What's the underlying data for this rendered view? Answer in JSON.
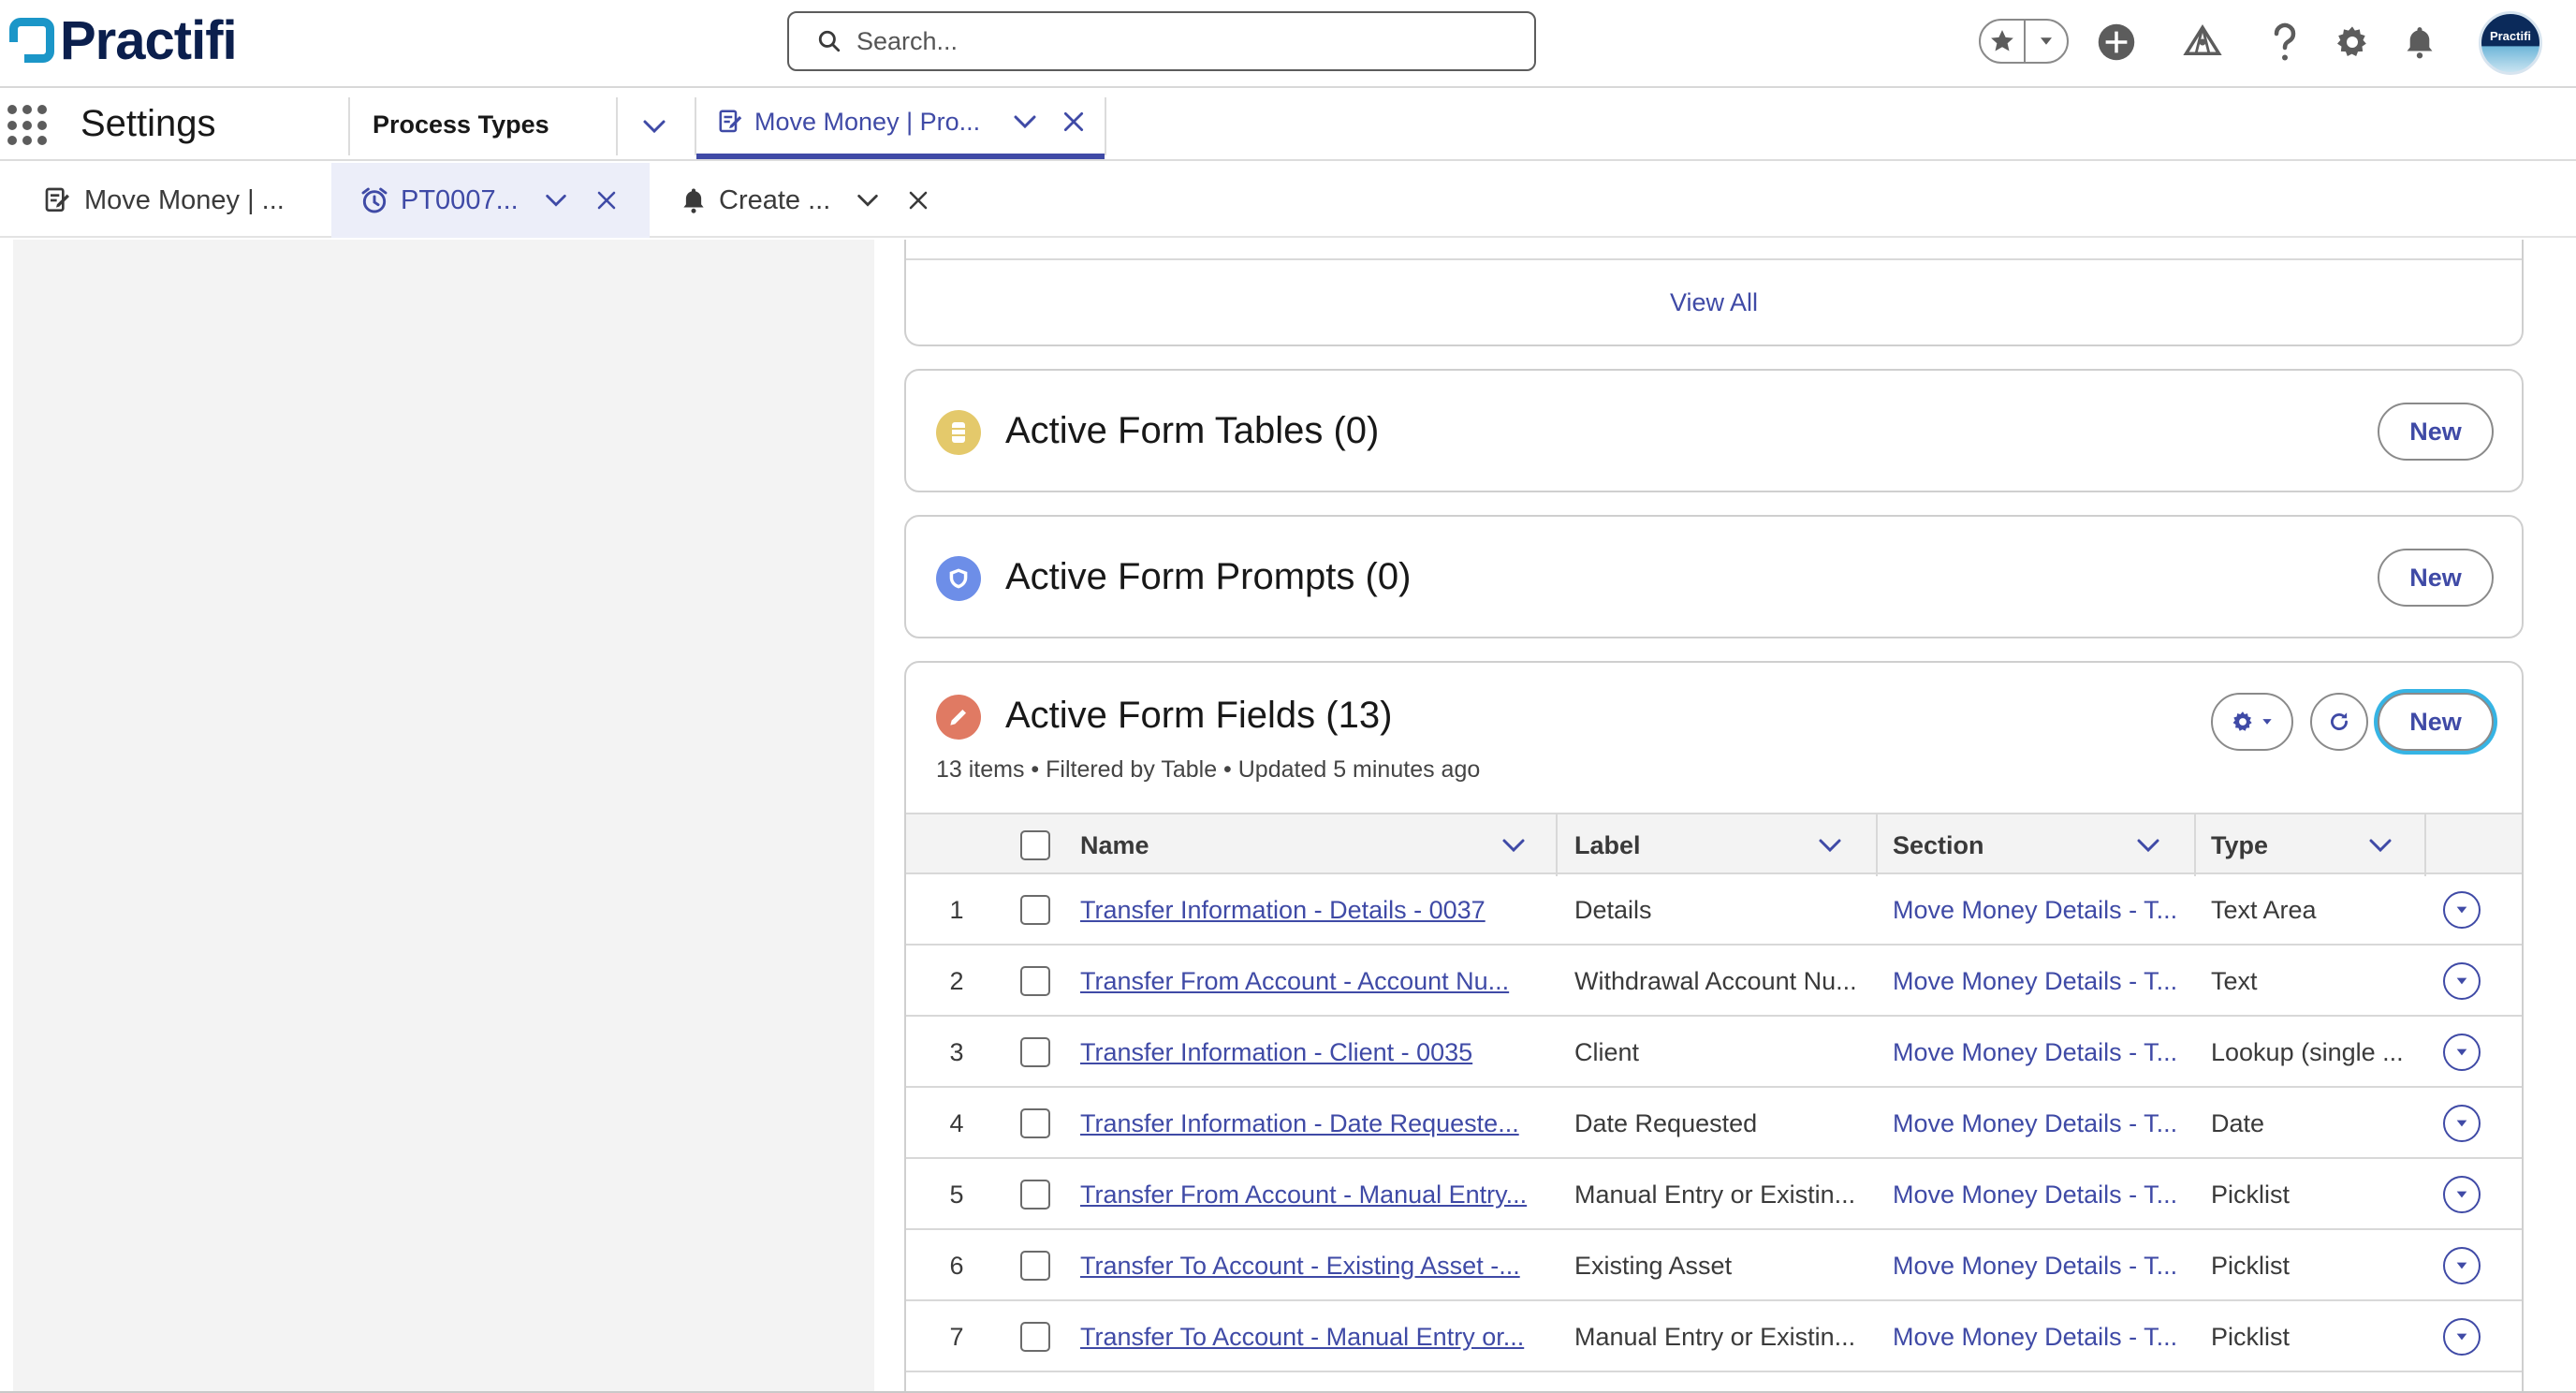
{
  "header": {
    "logo_text": "Practifi",
    "search_placeholder": "Search...",
    "avatar_text": "Practifi"
  },
  "nav": {
    "app_name": "Settings",
    "items": [
      {
        "label": "Process Types"
      }
    ],
    "active_tab": {
      "label": "Move Money | Pro..."
    }
  },
  "subtabs": [
    {
      "label": "Move Money | ..."
    },
    {
      "label": "PT0007..."
    },
    {
      "label": "Create ..."
    }
  ],
  "related": {
    "view_all": "View All",
    "tables": {
      "title": "Active Form Tables (0)",
      "new_label": "New",
      "icon_color": "#e4c96b"
    },
    "prompts": {
      "title": "Active Form Prompts (0)",
      "new_label": "New",
      "icon_color": "#6d8ee8"
    },
    "fields": {
      "title": "Active Form Fields (13)",
      "new_label": "New",
      "icon_color": "#e07a63",
      "meta": "13 items • Filtered by Table • Updated 5 minutes ago",
      "columns": [
        "Name",
        "Label",
        "Section",
        "Type"
      ],
      "rows": [
        {
          "num": "1",
          "name": "Transfer Information - Details - 0037",
          "label": "Details",
          "section": "Move Money Details - T...",
          "type": "Text Area"
        },
        {
          "num": "2",
          "name": "Transfer From Account - Account Nu...",
          "label": "Withdrawal Account Nu...",
          "section": "Move Money Details - T...",
          "type": "Text"
        },
        {
          "num": "3",
          "name": "Transfer Information - Client - 0035",
          "label": "Client",
          "section": "Move Money Details - T...",
          "type": "Lookup (single ..."
        },
        {
          "num": "4",
          "name": "Transfer Information - Date Requeste...",
          "label": "Date Requested",
          "section": "Move Money Details - T...",
          "type": "Date"
        },
        {
          "num": "5",
          "name": "Transfer From Account - Manual Entry...",
          "label": "Manual Entry or Existin...",
          "section": "Move Money Details - T...",
          "type": "Picklist"
        },
        {
          "num": "6",
          "name": "Transfer To Account - Existing Asset -...",
          "label": "Existing Asset",
          "section": "Move Money Details - T...",
          "type": "Picklist"
        },
        {
          "num": "7",
          "name": "Transfer To Account - Manual Entry or...",
          "label": "Manual Entry or Existin...",
          "section": "Move Money Details - T...",
          "type": "Picklist"
        }
      ]
    }
  }
}
